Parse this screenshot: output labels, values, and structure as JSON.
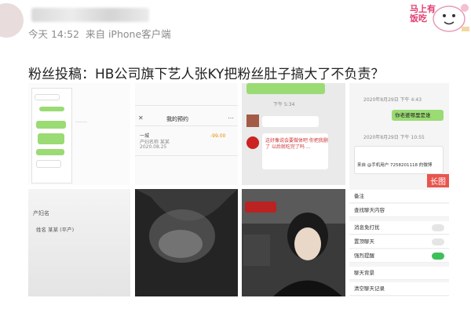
{
  "post": {
    "time": "今天 14:52",
    "source": "来自 iPhone客户端",
    "text": "粉丝投稿：HB公司旗下艺人张KY把粉丝肚子搞大了不负责？"
  },
  "sticker": {
    "caption": "马上有饭吃"
  },
  "thumbs": {
    "t2_title": "我的预约",
    "t2_amount": "-99.00",
    "t3_time": "下午 5:34",
    "t4_line": "产妇名",
    "t7_date1": "2020年8月29日 下午 4:43",
    "t7_bubble": "你老婆哪里是谁",
    "t7_date2": "2020年8月29日 下午 10:55",
    "t7_card_from": "来自 @手机用户 7258201118 的微博",
    "t7_badge": "长图",
    "t7_rows": [
      "备注",
      "查找聊天内容",
      "消息免打扰",
      "置顶聊天",
      "强烈提醒",
      "聊天背景",
      "清空聊天记录"
    ]
  }
}
